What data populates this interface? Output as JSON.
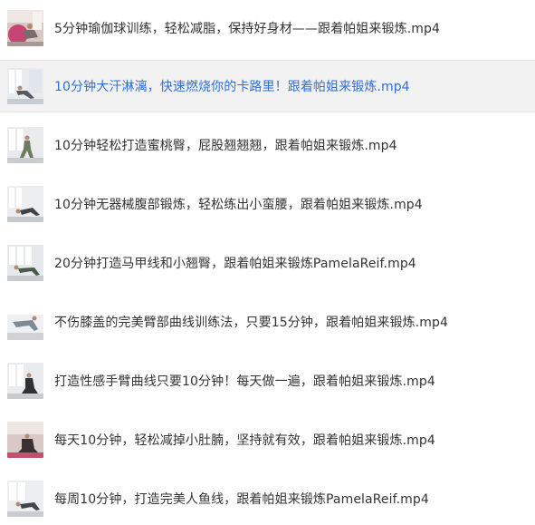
{
  "files": [
    {
      "name": "5分钟瑜伽球训练，轻松减脂，保持好身材——跟着帕姐来锻炼.mp4",
      "thumbnail": "yoga-ball-thumbnail",
      "selected": false
    },
    {
      "name": "10分钟大汗淋漓，快速燃烧你的卡路里！跟着帕姐来锻炼.mp4",
      "thumbnail": "workout-thumbnail",
      "selected": true
    },
    {
      "name": "10分钟轻松打造蜜桃臀，屁股翘翘翘，跟着帕姐来锻炼.mp4",
      "thumbnail": "workout-thumbnail",
      "selected": false
    },
    {
      "name": "10分钟无器械腹部锻炼，轻松练出小蛮腰，跟着帕姐来锻炼.mp4",
      "thumbnail": "workout-thumbnail",
      "selected": false
    },
    {
      "name": "20分钟打造马甲线和小翘臀，跟着帕姐来锻炼PamelaReif.mp4",
      "thumbnail": "workout-thumbnail",
      "selected": false
    },
    {
      "name": "不伤膝盖的完美臂部曲线训练法，只要15分钟，跟着帕姐来锻炼.mp4",
      "thumbnail": "workout-thumbnail",
      "selected": false
    },
    {
      "name": "打造性感手臂曲线只要10分钟！每天做一遍，跟着帕姐来锻炼.mp4",
      "thumbnail": "workout-thumbnail",
      "selected": false
    },
    {
      "name": "每天10分钟，轻松减掉小肚腩，坚持就有效，跟着帕姐来锻炼.mp4",
      "thumbnail": "workout-thumbnail",
      "selected": false
    },
    {
      "name": "每周10分钟，打造完美人鱼线，跟着帕姐来锻炼PamelaReif.mp4",
      "thumbnail": "workout-thumbnail",
      "selected": false
    }
  ],
  "colors": {
    "selected_text": "#2f6fd6",
    "text": "#333333",
    "selected_background": "#f2f2f2"
  }
}
